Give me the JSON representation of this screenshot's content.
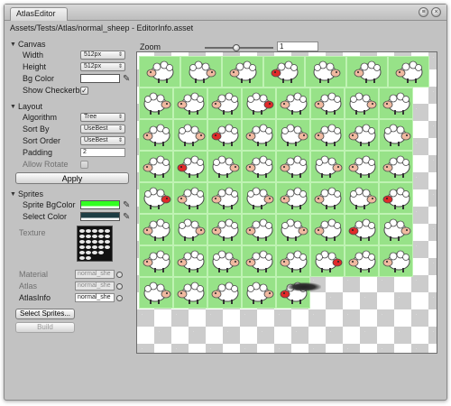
{
  "window": {
    "tab_title": "AtlasEditor",
    "path": "Assets/Tests/Atlas/normal_sheep - EditorInfo.asset"
  },
  "canvas_section": {
    "header": "Canvas",
    "width_label": "Width",
    "width_value": "512px",
    "height_label": "Height",
    "height_value": "512px",
    "bg_color_label": "Bg Color",
    "bg_color": "#ffffff",
    "show_checkerboard_label": "Show Checkerboa",
    "show_checkerboard_checked": true
  },
  "layout_section": {
    "header": "Layout",
    "algorithm_label": "Algorithm",
    "algorithm_value": "Tree",
    "sort_by_label": "Sort By",
    "sort_by_value": "UseBest",
    "sort_order_label": "Sort Order",
    "sort_order_value": "UseBest",
    "padding_label": "Padding",
    "padding_value": "2",
    "allow_rotate_label": "Allow Rotate",
    "apply_label": "Apply"
  },
  "sprites_section": {
    "header": "Sprites",
    "sprite_bg_color_label": "Sprite BgColor",
    "sprite_bg_color": "#33ff22",
    "select_color_label": "Select Color",
    "select_color": "#1e3d44",
    "texture_label": "Texture",
    "material_label": "Material",
    "material_value": "normal_she",
    "atlas_label": "Atlas",
    "atlas_value": "normal_she",
    "atlasinfo_label": "AtlasInfo",
    "atlasinfo_value": "normal_she",
    "select_sprites_label": "Select Sprites...",
    "build_label": "Build"
  },
  "zoom": {
    "label": "Zoom",
    "value": "1",
    "slider_fraction": 0.45
  },
  "colors": {
    "sprite_cell": "#97e288",
    "checker_dark": "#cccccc",
    "checker_light": "#ffffff"
  },
  "atlas": {
    "row_counts": [
      7,
      8,
      8,
      8,
      8,
      8,
      8,
      5
    ],
    "wide_rows": [
      0
    ]
  }
}
